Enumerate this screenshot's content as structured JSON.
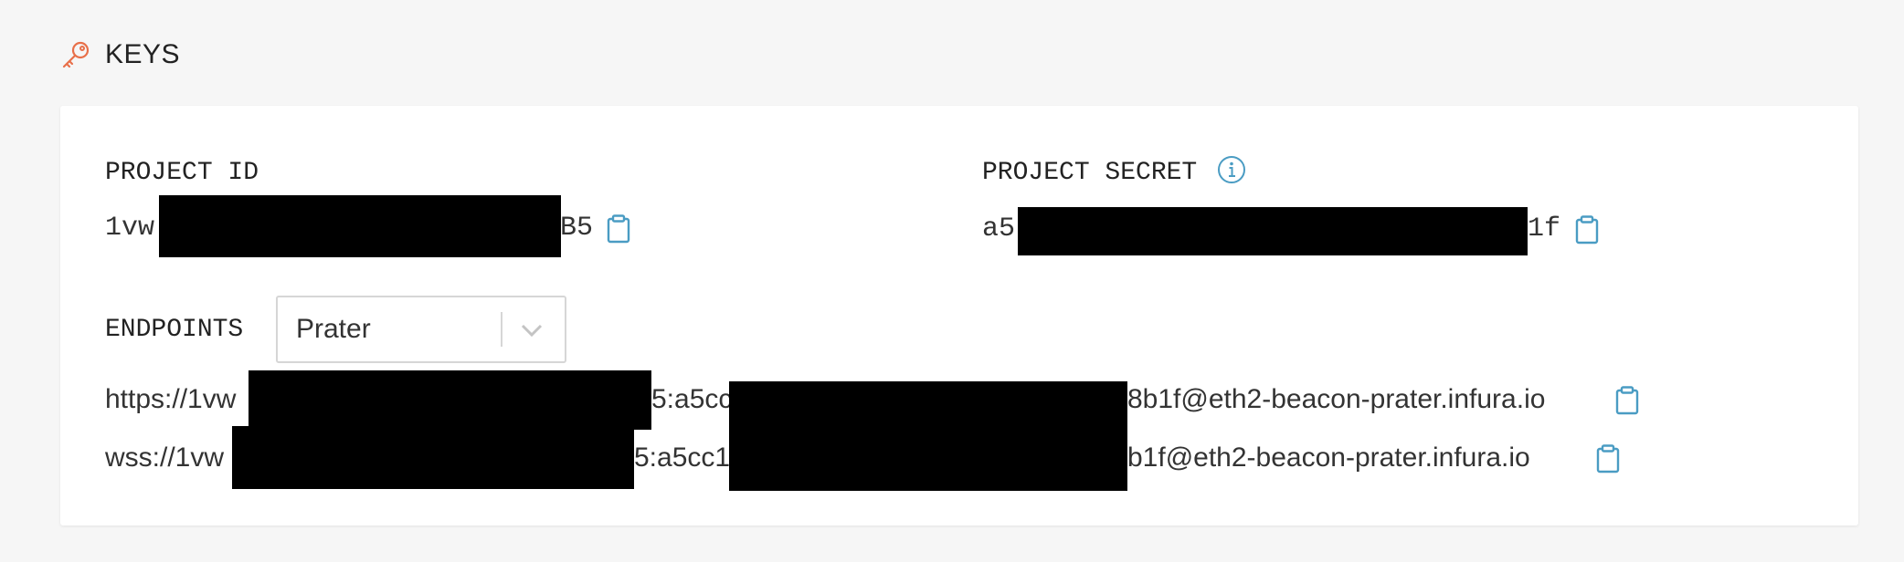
{
  "section": {
    "icon": "key-icon",
    "title": "KEYS"
  },
  "project_id": {
    "label": "PROJECT ID",
    "value_start": "1vw",
    "value_end": "B5",
    "copy_icon": "clipboard-icon"
  },
  "project_secret": {
    "label": "PROJECT SECRET",
    "info_icon": "info-icon",
    "value_start": "a5",
    "value_end": "1f",
    "copy_icon": "clipboard-icon"
  },
  "endpoints": {
    "label": "ENDPOINTS",
    "network_selected": "Prater",
    "https": {
      "start": "https://1vw",
      "mid": "5:a5cc",
      "end": "8b1f@eth2-beacon-prater.infura.io"
    },
    "wss": {
      "start": "wss://1vw",
      "mid": "5:a5cc1",
      "end": "b1f@eth2-beacon-prater.infura.io"
    }
  },
  "colors": {
    "accent": "#e8704a",
    "icon_blue": "#4a9cc3",
    "background": "#f6f6f6",
    "card": "#ffffff",
    "redaction": "#000000"
  }
}
